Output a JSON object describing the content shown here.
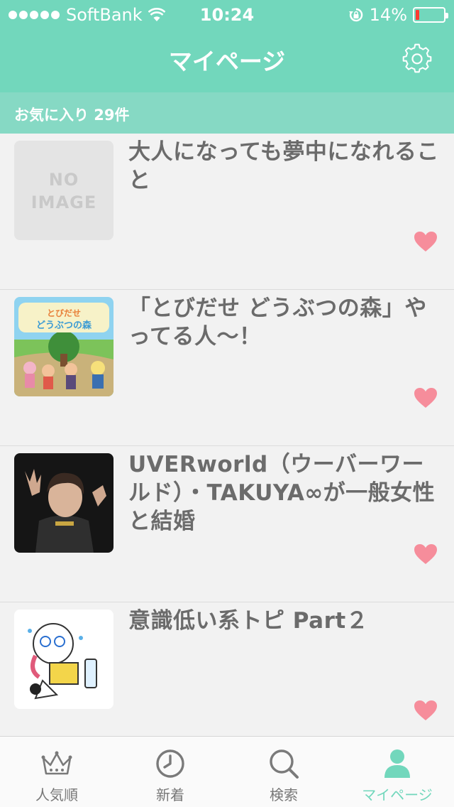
{
  "status_bar": {
    "carrier": "SoftBank",
    "time": "10:24",
    "battery_percent": "14%",
    "battery_level": 0.14
  },
  "navbar": {
    "title": "マイページ",
    "settings_icon": "gear-icon"
  },
  "favorites": {
    "label": "お気に入り 29件"
  },
  "items": [
    {
      "title": "大人になっても夢中になれること",
      "thumbnail_text": "NO IMAGE",
      "favorited": true
    },
    {
      "title": "「とびだせ どうぶつの森」やってる人〜！",
      "thumbnail_text": "とびだせ どうぶつの森",
      "favorited": true
    },
    {
      "title": "UVERworld（ウーバーワールド）・TAKUYA∞が一般女性と結婚",
      "thumbnail_text": "",
      "favorited": true
    },
    {
      "title": "意識低い系トピ Part２",
      "thumbnail_text": "",
      "favorited": true
    }
  ],
  "tabs": [
    {
      "label": "人気順",
      "icon": "crown-icon",
      "active": false
    },
    {
      "label": "新着",
      "icon": "clock-icon",
      "active": false
    },
    {
      "label": "検索",
      "icon": "search-icon",
      "active": false
    },
    {
      "label": "マイページ",
      "icon": "person-icon",
      "active": true
    }
  ],
  "colors": {
    "accent": "#72d7bc",
    "heart": "#f68d9b",
    "battery_low": "#ff3b30"
  }
}
